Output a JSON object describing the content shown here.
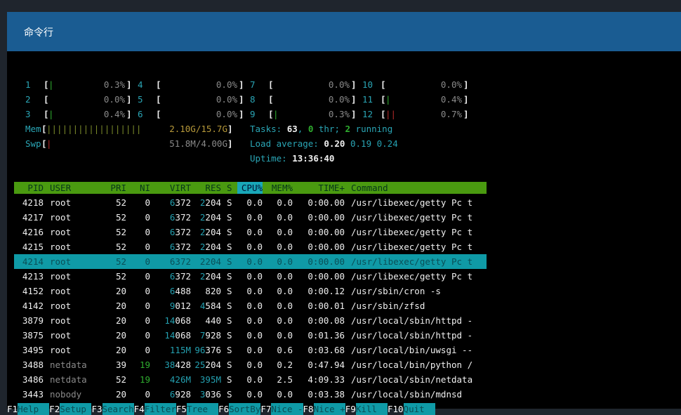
{
  "window": {
    "title": "命令行"
  },
  "cpus": [
    {
      "n": "1",
      "bar": "|",
      "pct": "0.3%"
    },
    {
      "n": "2",
      "bar": "",
      "pct": "0.0%"
    },
    {
      "n": "3",
      "bar": "|",
      "pct": "0.4%"
    },
    {
      "n": "4",
      "bar": "",
      "pct": "0.0%"
    },
    {
      "n": "5",
      "bar": "",
      "pct": "0.0%"
    },
    {
      "n": "6",
      "bar": "",
      "pct": "0.0%"
    },
    {
      "n": "7",
      "bar": "",
      "pct": "0.0%"
    },
    {
      "n": "8",
      "bar": "",
      "pct": "0.0%"
    },
    {
      "n": "9",
      "bar": "|",
      "pct": "0.3%"
    },
    {
      "n": "10",
      "bar": "",
      "pct": "0.0%"
    },
    {
      "n": "11",
      "bar": "|",
      "pct": "0.4%"
    },
    {
      "n": "12",
      "bar": "||",
      "pct": "0.7%"
    }
  ],
  "mem": {
    "label": "Mem",
    "bars": "||||||||||||||||||",
    "value": "2.10G/15.7G"
  },
  "swp": {
    "label": "Swp",
    "bars": "|",
    "value": "51.8M/4.00G"
  },
  "tasks": {
    "label": "Tasks: ",
    "total": "63",
    "sep": ", ",
    "thr": "0",
    "thr_label": " thr; ",
    "running": "2",
    "running_label": " running"
  },
  "load": {
    "label": "Load average: ",
    "one": "0.20",
    "five": "0.19",
    "fifteen": "0.24"
  },
  "uptime": {
    "label": "Uptime: ",
    "value": "13:36:40"
  },
  "columns": [
    "PID",
    "USER",
    "PRI",
    "NI",
    "VIRT",
    "RES",
    "S",
    "CPU%",
    "MEM%",
    "TIME+",
    "Command"
  ],
  "processes": [
    {
      "pid": "4218",
      "user": "root",
      "pri": "52",
      "ni": "0",
      "virt_hi": "6",
      "virt_lo": "372",
      "res_hi": "2",
      "res_lo": "204",
      "s": "S",
      "cpu": "0.0",
      "mem": "0.0",
      "time": "0:00.00",
      "cmd": "/usr/libexec/getty Pc t"
    },
    {
      "pid": "4217",
      "user": "root",
      "pri": "52",
      "ni": "0",
      "virt_hi": "6",
      "virt_lo": "372",
      "res_hi": "2",
      "res_lo": "204",
      "s": "S",
      "cpu": "0.0",
      "mem": "0.0",
      "time": "0:00.00",
      "cmd": "/usr/libexec/getty Pc t"
    },
    {
      "pid": "4216",
      "user": "root",
      "pri": "52",
      "ni": "0",
      "virt_hi": "6",
      "virt_lo": "372",
      "res_hi": "2",
      "res_lo": "204",
      "s": "S",
      "cpu": "0.0",
      "mem": "0.0",
      "time": "0:00.00",
      "cmd": "/usr/libexec/getty Pc t"
    },
    {
      "pid": "4215",
      "user": "root",
      "pri": "52",
      "ni": "0",
      "virt_hi": "6",
      "virt_lo": "372",
      "res_hi": "2",
      "res_lo": "204",
      "s": "S",
      "cpu": "0.0",
      "mem": "0.0",
      "time": "0:00.00",
      "cmd": "/usr/libexec/getty Pc t"
    },
    {
      "pid": "4214",
      "user": "root",
      "pri": "52",
      "ni": "0",
      "virt_hi": "6",
      "virt_lo": "372",
      "res_hi": "2",
      "res_lo": "204",
      "s": "S",
      "cpu": "0.0",
      "mem": "0.0",
      "time": "0:00.00",
      "cmd": "/usr/libexec/getty Pc t",
      "selected": true
    },
    {
      "pid": "4213",
      "user": "root",
      "pri": "52",
      "ni": "0",
      "virt_hi": "6",
      "virt_lo": "372",
      "res_hi": "2",
      "res_lo": "204",
      "s": "S",
      "cpu": "0.0",
      "mem": "0.0",
      "time": "0:00.00",
      "cmd": "/usr/libexec/getty Pc t"
    },
    {
      "pid": "4152",
      "user": "root",
      "pri": "20",
      "ni": "0",
      "virt_hi": "6",
      "virt_lo": "488",
      "res_hi": "",
      "res_lo": "820",
      "s": "S",
      "cpu": "0.0",
      "mem": "0.0",
      "time": "0:00.12",
      "cmd": "/usr/sbin/cron -s"
    },
    {
      "pid": "4142",
      "user": "root",
      "pri": "20",
      "ni": "0",
      "virt_hi": "9",
      "virt_lo": "012",
      "res_hi": "4",
      "res_lo": "584",
      "s": "S",
      "cpu": "0.0",
      "mem": "0.0",
      "time": "0:00.01",
      "cmd": "/usr/sbin/zfsd"
    },
    {
      "pid": "3879",
      "user": "root",
      "pri": "20",
      "ni": "0",
      "virt_hi": "14",
      "virt_lo": "068",
      "res_hi": "",
      "res_lo": "440",
      "s": "S",
      "cpu": "0.0",
      "mem": "0.0",
      "time": "0:00.08",
      "cmd": "/usr/local/sbin/httpd -"
    },
    {
      "pid": "3875",
      "user": "root",
      "pri": "20",
      "ni": "0",
      "virt_hi": "14",
      "virt_lo": "068",
      "res_hi": "7",
      "res_lo": "928",
      "s": "S",
      "cpu": "0.0",
      "mem": "0.0",
      "time": "0:01.36",
      "cmd": "/usr/local/sbin/httpd -"
    },
    {
      "pid": "3495",
      "user": "root",
      "pri": "20",
      "ni": "0",
      "virt_hi": "115M",
      "virt_lo": "",
      "res_hi": "96",
      "res_lo": "376",
      "s": "S",
      "cpu": "0.0",
      "mem": "0.6",
      "time": "0:03.68",
      "cmd": "/usr/local/bin/uwsgi --"
    },
    {
      "pid": "3488",
      "user": "netdata",
      "pri": "39",
      "ni": "19",
      "virt_hi": "38",
      "virt_lo": "428",
      "res_hi": "25",
      "res_lo": "204",
      "s": "S",
      "cpu": "0.0",
      "mem": "0.2",
      "time": "0:47.94",
      "cmd": "/usr/local/bin/python /"
    },
    {
      "pid": "3486",
      "user": "netdata",
      "pri": "52",
      "ni": "19",
      "virt_hi": "426M",
      "virt_lo": "",
      "res_hi": "395M",
      "res_lo": "",
      "s": "S",
      "cpu": "0.0",
      "mem": "2.5",
      "time": "4:09.33",
      "cmd": "/usr/local/sbin/netdata"
    },
    {
      "pid": "3443",
      "user": "nobody",
      "pri": "20",
      "ni": "0",
      "virt_hi": "6",
      "virt_lo": "928",
      "res_hi": "3",
      "res_lo": "036",
      "s": "S",
      "cpu": "0.0",
      "mem": "0.0",
      "time": "0:03.38",
      "cmd": "/usr/local/sbin/mdnsd"
    }
  ],
  "fkeys": [
    {
      "key": "F1",
      "label": "Help  "
    },
    {
      "key": "F2",
      "label": "Setup "
    },
    {
      "key": "F3",
      "label": "Search"
    },
    {
      "key": "F4",
      "label": "Filter"
    },
    {
      "key": "F5",
      "label": "Tree  "
    },
    {
      "key": "F6",
      "label": "SortBy"
    },
    {
      "key": "F7",
      "label": "Nice -"
    },
    {
      "key": "F8",
      "label": "Nice +"
    },
    {
      "key": "F9",
      "label": "Kill  "
    },
    {
      "key": "F10",
      "label": "Quit  "
    }
  ]
}
